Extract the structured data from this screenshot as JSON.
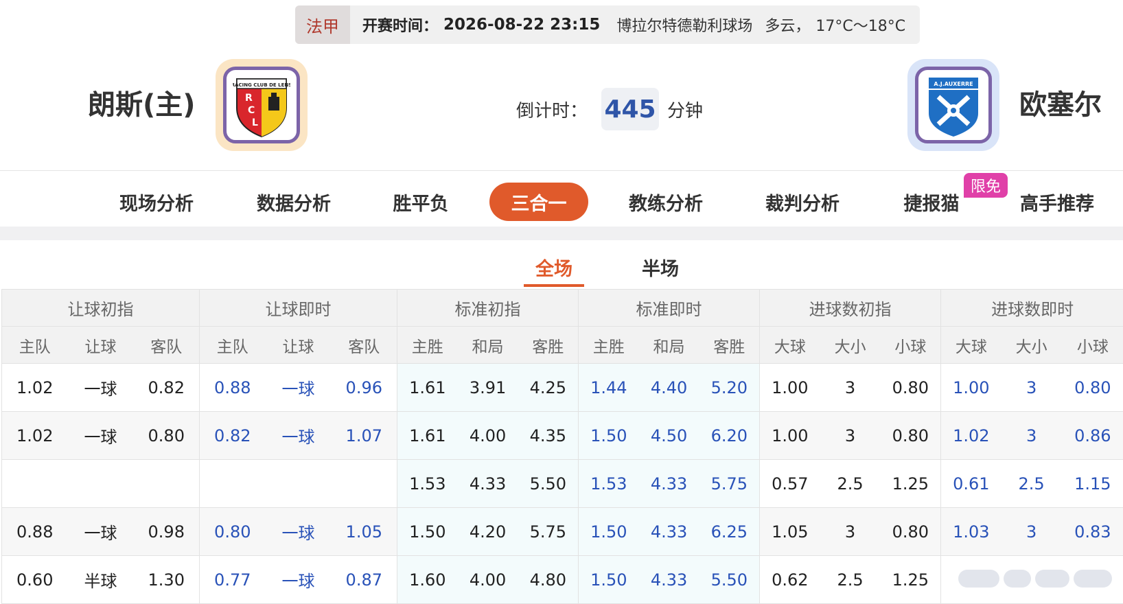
{
  "match_info": {
    "league": "法甲",
    "kickoff_label": "开赛时间：",
    "kickoff_time": "2026-08-22 23:15",
    "venue": "博拉尔特德勒利球场",
    "weather": "多云，",
    "temperature": "17°C～18°C"
  },
  "home_team": {
    "name": "朗斯(主)",
    "logo_icon": "rc-lens-crest"
  },
  "away_team": {
    "name": "欧塞尔",
    "logo_icon": "aj-auxerre-crest"
  },
  "countdown": {
    "label": "倒计时：",
    "value": "445",
    "unit": "分钟"
  },
  "nav": {
    "tabs": [
      {
        "label": "现场分析"
      },
      {
        "label": "数据分析"
      },
      {
        "label": "胜平负"
      },
      {
        "label": "三合一"
      },
      {
        "label": "教练分析"
      },
      {
        "label": "裁判分析"
      },
      {
        "label": "捷报猫"
      },
      {
        "label": "高手推荐"
      }
    ],
    "active_index": 3,
    "badge": "限免"
  },
  "subtabs": {
    "full": "全场",
    "half": "半场",
    "active": "full"
  },
  "table": {
    "groups": [
      "让球初指",
      "让球即时",
      "标准初指",
      "标准即时",
      "进球数初指",
      "进球数即时"
    ],
    "subheaders": [
      "主队",
      "让球",
      "客队",
      "主队",
      "让球",
      "客队",
      "主胜",
      "和局",
      "客胜",
      "主胜",
      "和局",
      "客胜",
      "大球",
      "大小",
      "小球",
      "大球",
      "大小",
      "小球"
    ],
    "rows": [
      [
        "1.02",
        "一球",
        "0.82",
        "0.88",
        "一球",
        "0.96",
        "1.61",
        "3.91",
        "4.25",
        "1.44",
        "4.40",
        "5.20",
        "1.00",
        "3",
        "0.80",
        "1.00",
        "3",
        "0.80"
      ],
      [
        "1.02",
        "一球",
        "0.80",
        "0.82",
        "一球",
        "1.07",
        "1.61",
        "4.00",
        "4.35",
        "1.50",
        "4.50",
        "6.20",
        "1.00",
        "3",
        "0.80",
        "1.02",
        "3",
        "0.86"
      ],
      [
        "",
        "",
        "",
        "",
        "",
        "",
        "1.53",
        "4.33",
        "5.50",
        "1.53",
        "4.33",
        "5.75",
        "0.57",
        "2.5",
        "1.25",
        "0.61",
        "2.5",
        "1.15"
      ],
      [
        "0.88",
        "一球",
        "0.98",
        "0.80",
        "一球",
        "1.05",
        "1.50",
        "4.20",
        "5.75",
        "1.50",
        "4.33",
        "6.25",
        "1.05",
        "3",
        "0.80",
        "1.03",
        "3",
        "0.83"
      ],
      [
        "0.60",
        "半球",
        "1.30",
        "0.77",
        "一球",
        "0.87",
        "1.60",
        "4.00",
        "4.80",
        "1.50",
        "4.33",
        "5.50",
        "0.62",
        "2.5",
        "1.25",
        "",
        "",
        ""
      ]
    ]
  },
  "colors": {
    "accent": "#e05a2b",
    "live_odds": "#2952b8",
    "badge": "#e040a8"
  }
}
